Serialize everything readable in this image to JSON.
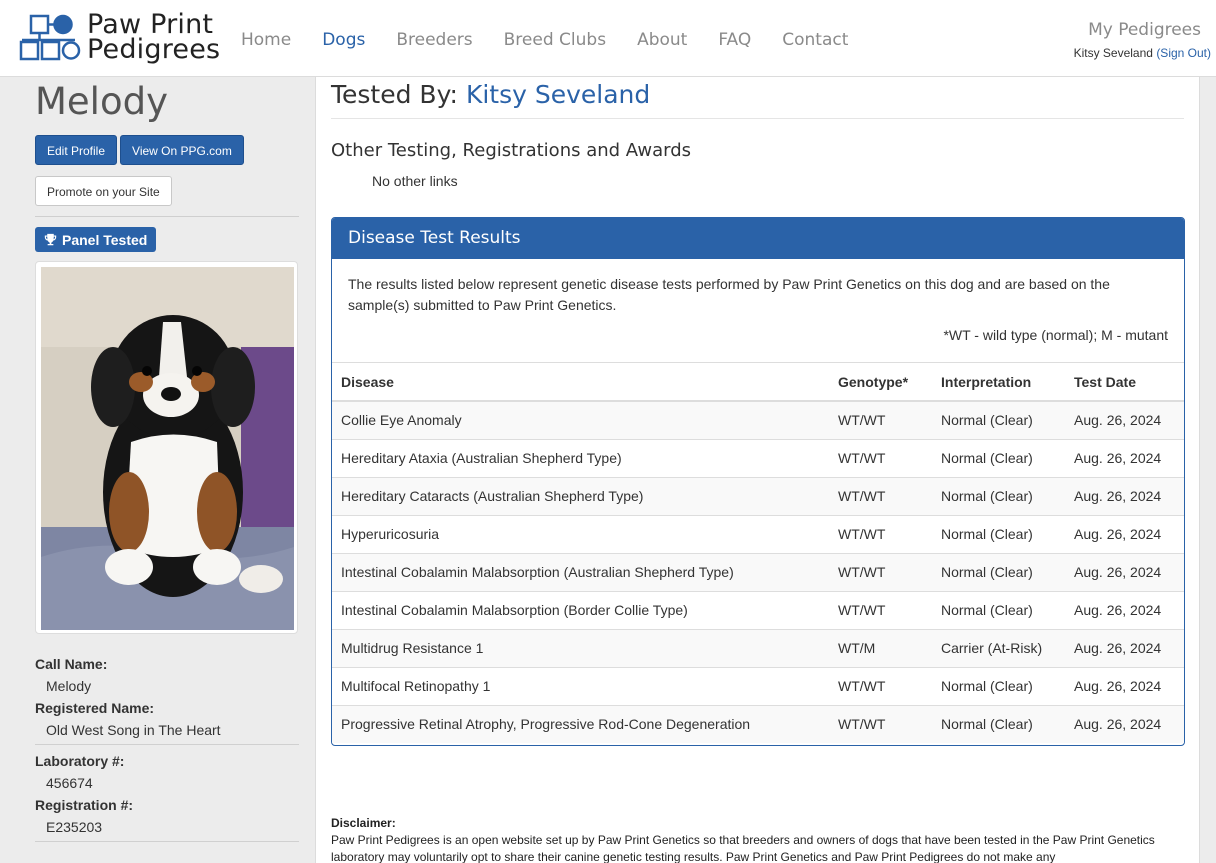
{
  "header": {
    "logo_line1": "Paw Print",
    "logo_line2": "Pedigrees",
    "nav": [
      "Home",
      "Dogs",
      "Breeders",
      "Breed Clubs",
      "About",
      "FAQ",
      "Contact"
    ],
    "active_nav": "Dogs",
    "my_pedigrees": "My Pedigrees",
    "user_name": "Kitsy Seveland",
    "sign_out": "(Sign Out)"
  },
  "sidebar": {
    "dog_name": "Melody",
    "edit_profile": "Edit Profile",
    "view_on": "View On PPG.com",
    "promote": "Promote on your Site",
    "badge": "Panel Tested",
    "fields": [
      {
        "label": "Call Name:",
        "value": "Melody"
      },
      {
        "label": "Registered Name:",
        "value": "Old West Song in The Heart"
      },
      {
        "label": "Laboratory #:",
        "value": "456674"
      },
      {
        "label": "Registration #:",
        "value": "E235203"
      }
    ]
  },
  "main": {
    "tested_by_label": "Tested By:",
    "tested_by_name": "Kitsy Seveland",
    "other_title": "Other Testing, Registrations and Awards",
    "other_value": "No other links",
    "panel_title": "Disease Test Results",
    "panel_intro": "The results listed below represent genetic disease tests performed by Paw Print Genetics on this dog and are based on the sample(s) submitted to Paw Print Genetics.",
    "panel_note": "*WT - wild type (normal); M - mutant",
    "columns": [
      "Disease",
      "Genotype*",
      "Interpretation",
      "Test Date"
    ],
    "rows": [
      [
        "Collie Eye Anomaly",
        "WT/WT",
        "Normal (Clear)",
        "Aug. 26, 2024"
      ],
      [
        "Hereditary Ataxia (Australian Shepherd Type)",
        "WT/WT",
        "Normal (Clear)",
        "Aug. 26, 2024"
      ],
      [
        "Hereditary Cataracts (Australian Shepherd Type)",
        "WT/WT",
        "Normal (Clear)",
        "Aug. 26, 2024"
      ],
      [
        "Hyperuricosuria",
        "WT/WT",
        "Normal (Clear)",
        "Aug. 26, 2024"
      ],
      [
        "Intestinal Cobalamin Malabsorption (Australian Shepherd Type)",
        "WT/WT",
        "Normal (Clear)",
        "Aug. 26, 2024"
      ],
      [
        "Intestinal Cobalamin Malabsorption (Border Collie Type)",
        "WT/WT",
        "Normal (Clear)",
        "Aug. 26, 2024"
      ],
      [
        "Multidrug Resistance 1",
        "WT/M",
        "Carrier (At-Risk)",
        "Aug. 26, 2024"
      ],
      [
        "Multifocal Retinopathy 1",
        "WT/WT",
        "Normal (Clear)",
        "Aug. 26, 2024"
      ],
      [
        "Progressive Retinal Atrophy, Progressive Rod-Cone Degeneration",
        "WT/WT",
        "Normal (Clear)",
        "Aug. 26, 2024"
      ]
    ],
    "disclaimer_title": "Disclaimer:",
    "disclaimer_text": "Paw Print Pedigrees is an open website set up by Paw Print Genetics so that breeders and owners of dogs that have been tested in the Paw Print Genetics laboratory may voluntarily opt to share their canine genetic testing results. Paw Print Genetics and Paw Print Pedigrees do not make any"
  },
  "colors": {
    "brand": "#2a62a8",
    "sidebar_bg": "#ececec"
  },
  "icons": [
    "logo-pedigree-icon",
    "trophy-icon"
  ]
}
